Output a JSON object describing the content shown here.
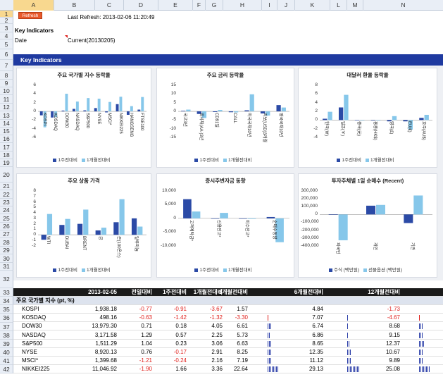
{
  "columns": [
    "A",
    "B",
    "C",
    "D",
    "E",
    "F",
    "G",
    "H",
    "I",
    "J",
    "K",
    "L",
    "M",
    "N"
  ],
  "rows": [
    "1",
    "2",
    "3",
    "4",
    "5",
    "6",
    "7",
    "8",
    "9",
    "10",
    "11",
    "12",
    "13",
    "14",
    "15",
    "16",
    "17",
    "18",
    "19",
    "20",
    "21",
    "22",
    "23",
    "24",
    "25",
    "26",
    "27",
    "28",
    "29",
    "30",
    "31",
    "32",
    "33",
    "34",
    "35",
    "36",
    "37",
    "38",
    "39",
    "40",
    "41",
    "42"
  ],
  "header": {
    "refresh_label": "Refresh",
    "last_refresh": "Last Refresh: 2013-02-06 11:20:49",
    "key_indicators": "Key Indicators",
    "date_label": "Date",
    "date_value": "Current(20130205)"
  },
  "banner": "Key Indicators",
  "colors": {
    "series1": "#2b4aa6",
    "series2": "#86c7ea",
    "banner": "#1f3aa0",
    "negative": "#e0201c"
  },
  "legend_main": [
    "1주전대비",
    "1개월전대비"
  ],
  "chart_data": [
    {
      "type": "bar",
      "title": "주요 국가별 지수 등락율",
      "categories": [
        "KOSPI",
        "KOSDAQ",
        "DOW30",
        "NASDAQ",
        "S&P500",
        "NYSE",
        "MSCI*",
        "NIKKEI225",
        "HANGSENG",
        "FTSE100"
      ],
      "series": [
        {
          "name": "1주전대비",
          "values": [
            -0.91,
            -1.42,
            0.18,
            0.57,
            0.23,
            0.76,
            -0.24,
            1.66,
            -0.8,
            0.4
          ]
        },
        {
          "name": "1개월전대비",
          "values": [
            -3.67,
            -1.32,
            4.05,
            2.25,
            3.06,
            2.91,
            2.16,
            3.36,
            1.2,
            3.3
          ]
        }
      ],
      "ylim": [
        -6,
        6
      ],
      "yticks": [
        6,
        4,
        2,
        0,
        -2,
        -4,
        -6
      ]
    },
    {
      "type": "bar",
      "title": "주요 금리 등락율",
      "categories": [
        "국고3년",
        "회사채(AA-)3년",
        "CD91일",
        "CALL",
        "미국국채10년",
        "리보(USD)3개월",
        "영국국채10년"
      ],
      "series": [
        {
          "name": "1주전대비",
          "values": [
            0.3,
            -1.5,
            -0.4,
            -0.5,
            0.6,
            -1.2,
            3.6
          ]
        },
        {
          "name": "1개월전대비",
          "values": [
            1.0,
            -3.8,
            0.8,
            -0.6,
            9.8,
            -2.4,
            2.2
          ]
        }
      ],
      "ylim": [
        -15,
        15
      ],
      "yticks": [
        15,
        10,
        5,
        0,
        -5,
        -10,
        -15
      ]
    },
    {
      "type": "bar",
      "title": "대달러 환율 등락율",
      "categories": [
        "한국(￦)",
        "일본(￥)",
        "중국(元)",
        "홍콩(HK$)",
        "영국(£)",
        "EU(€)",
        "호주(AU$)"
      ],
      "series": [
        {
          "name": "1주전대비",
          "values": [
            0.3,
            2.9,
            0.05,
            -0.1,
            -0.3,
            -0.3,
            0.5
          ]
        },
        {
          "name": "1개월전대비",
          "values": [
            1.9,
            5.8,
            0.0,
            0.0,
            0.9,
            -2.2,
            1.2
          ]
        }
      ],
      "ylim": [
        -4,
        8
      ],
      "yticks": [
        8,
        6,
        4,
        2,
        0,
        -2,
        -4
      ]
    },
    {
      "type": "bar",
      "title": "주요 상품 가격",
      "categories": [
        "WTI",
        "DUBAI",
        "BRENT",
        "금",
        "은(100온스)",
        "알루미늄"
      ],
      "series": [
        {
          "name": "1주전대비",
          "values": [
            -0.9,
            1.8,
            2.0,
            0.8,
            2.3,
            3.0
          ]
        },
        {
          "name": "1개월전대비",
          "values": [
            3.8,
            2.9,
            4.6,
            1.3,
            6.5,
            1.5
          ]
        }
      ],
      "ylim": [
        -2,
        8
      ],
      "yticks": [
        8,
        7,
        6,
        5,
        4,
        3,
        2,
        1,
        0,
        -1,
        -2
      ]
    },
    {
      "type": "bar",
      "title": "증시주변자금 동향",
      "categories": [
        "고객예탁금*",
        "신용잔고*",
        "미수잔고*",
        "순매수동향"
      ],
      "series": [
        {
          "name": "1주전대비",
          "values": [
            7000,
            -150,
            -150,
            500
          ]
        },
        {
          "name": "1개월전대비",
          "values": [
            2500,
            2000,
            -200,
            -8700
          ]
        }
      ],
      "ylim": [
        -10000,
        10000
      ],
      "yticks": [
        "10,000",
        "5,000",
        "0",
        "-5,000",
        "-10,000"
      ]
    },
    {
      "type": "bar",
      "title": "투자주체별 1일 순매수 (Recent)",
      "categories": [
        "외국인",
        "개인",
        "기관"
      ],
      "series": [
        {
          "name": "주식 (백만원)",
          "values": [
            -5000,
            112000,
            -110000
          ]
        },
        {
          "name": "선물옵션 (백만원)",
          "values": [
            -330000,
            122000,
            242000
          ]
        }
      ],
      "ylim": [
        -400000,
        300000
      ],
      "yticks": [
        "300,000",
        "200,000",
        "100,000",
        "0",
        "-100,000",
        "-200,000",
        "-300,000",
        "-400,000"
      ]
    }
  ],
  "table": {
    "columns": [
      "2013-02-05",
      "전일대비",
      "1주전대비",
      "1개월전대비",
      "3개월전대비",
      "6개월전대비",
      "12개월전대비"
    ],
    "section": "주요 국가별 지수 (pt, %)",
    "rows": [
      {
        "name": "KOSPI",
        "v": "1,938.18",
        "d1": "-0.77",
        "w1": "-0.91",
        "m1": "-3.67",
        "m3": "1.57",
        "m6": "4.84",
        "m12": "-1.73",
        "s1": 0,
        "s2": 0,
        "s3": 0
      },
      {
        "name": "KOSDAQ",
        "v": "498.16",
        "d1": "-0.63",
        "w1": "-1.42",
        "m1": "-1.32",
        "m3": "-3.30",
        "m6": "7.07",
        "m12": "-4.67",
        "s1": 1,
        "s2": 1,
        "s3": 1
      },
      {
        "name": "DOW30",
        "v": "13,979.30",
        "d1": "0.71",
        "w1": "0.18",
        "m1": "4.05",
        "m3": "6.61",
        "m6": "6.74",
        "m12": "8.68",
        "s1": 3,
        "s2": 1,
        "s3": 3
      },
      {
        "name": "NASDAQ",
        "v": "3,171.58",
        "d1": "1.29",
        "w1": "0.57",
        "m1": "2.25",
        "m3": "5.73",
        "m6": "6.86",
        "m12": "9.15",
        "s1": 2,
        "s2": 1,
        "s3": 3
      },
      {
        "name": "S&P500",
        "v": "1,511.29",
        "d1": "1.04",
        "w1": "0.23",
        "m1": "3.06",
        "m3": "6.63",
        "m6": "8.65",
        "m12": "12.37",
        "s1": 3,
        "s2": 2,
        "s3": 4
      },
      {
        "name": "NYSE",
        "v": "8,920.13",
        "d1": "0.76",
        "w1": "-0.17",
        "m1": "2.91",
        "m3": "8.25",
        "m6": "12.35",
        "m12": "10.67",
        "s1": 3,
        "s2": 3,
        "s3": 3
      },
      {
        "name": "MSCI*",
        "v": "1,399.68",
        "d1": "-1.21",
        "w1": "-0.24",
        "m1": "2.16",
        "m3": "7.19",
        "m6": "11.12",
        "m12": "9.89",
        "s1": 3,
        "s2": 3,
        "s3": 3
      },
      {
        "name": "NIKKEI225",
        "v": "11,046.92",
        "d1": "-1.90",
        "w1": "1.66",
        "m1": "3.36",
        "m3": "22.64",
        "m6": "29.13",
        "m12": "25.08",
        "s1": 8,
        "s2": 9,
        "s3": 8
      }
    ]
  }
}
